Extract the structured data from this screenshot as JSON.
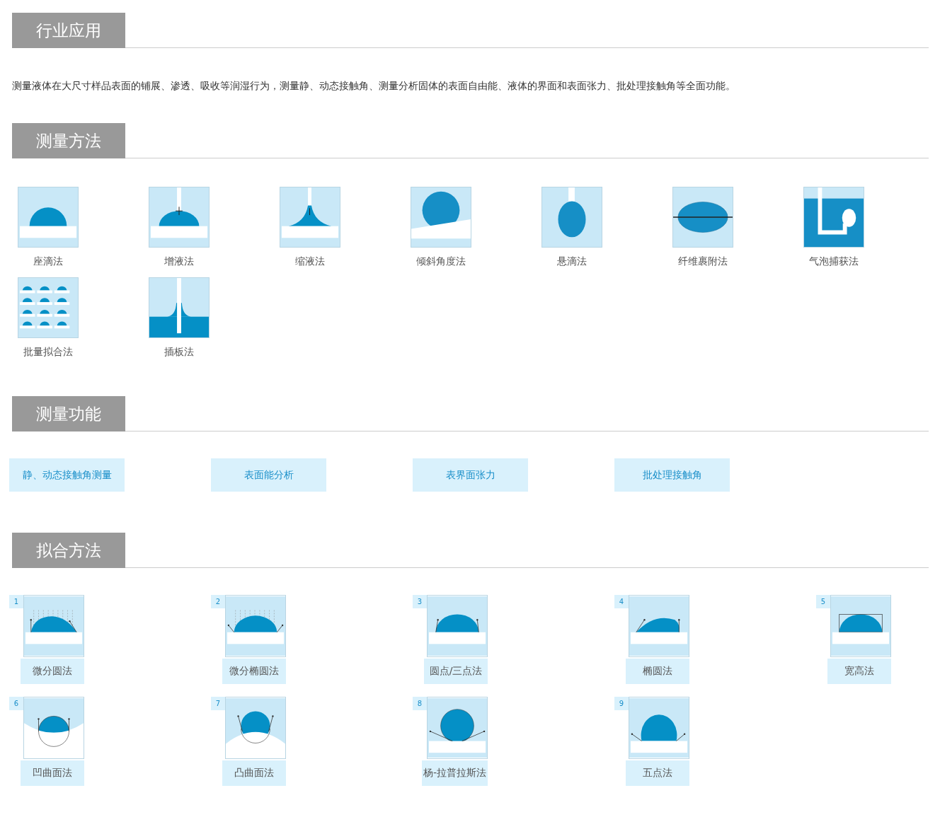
{
  "sections": [
    {
      "kind": "text",
      "title": "行业应用",
      "text": "测量液体在大尺寸样品表面的铺展、渗透、吸收等润湿行为，测量静、动态接触角、测量分析固体的表面自由能、液体的界面和表面张力、批处理接触角等全面功能。"
    },
    {
      "kind": "methods",
      "title": "测量方法",
      "items": [
        {
          "label": "座滴法",
          "kind": "sessile"
        },
        {
          "label": "增液法",
          "kind": "add-liquid"
        },
        {
          "label": "缩液法",
          "kind": "recede"
        },
        {
          "label": "倾斜角度法",
          "kind": "tilt"
        },
        {
          "label": "悬滴法",
          "kind": "pendant"
        },
        {
          "label": "纤维裹附法",
          "kind": "fiber"
        },
        {
          "label": "气泡捕获法",
          "kind": "bubble"
        },
        {
          "label": "批量拟合法",
          "kind": "batch"
        },
        {
          "label": "插板法",
          "kind": "plate"
        }
      ]
    },
    {
      "kind": "functions",
      "title": "测量功能",
      "items": [
        "静、动态接触角测量",
        "表面能分析",
        "表界面张力",
        "批处理接触角"
      ]
    },
    {
      "kind": "fitting",
      "title": "拟合方法",
      "items": [
        {
          "number": "1",
          "label": "微分圆法",
          "kind": "diff-circle"
        },
        {
          "number": "2",
          "label": "微分椭圆法",
          "kind": "diff-ellipse"
        },
        {
          "number": "3",
          "label": "圆点/三点法",
          "kind": "circle3"
        },
        {
          "number": "4",
          "label": "椭圆法",
          "kind": "ellipse"
        },
        {
          "number": "5",
          "label": "宽高法",
          "kind": "width-height"
        },
        {
          "number": "6",
          "label": "凹曲面法",
          "kind": "concave"
        },
        {
          "number": "7",
          "label": "凸曲面法",
          "kind": "convex"
        },
        {
          "number": "8",
          "label": "杨-拉普拉斯法",
          "kind": "young-laplace"
        },
        {
          "number": "9",
          "label": "五点法",
          "kind": "five-point"
        }
      ]
    }
  ]
}
